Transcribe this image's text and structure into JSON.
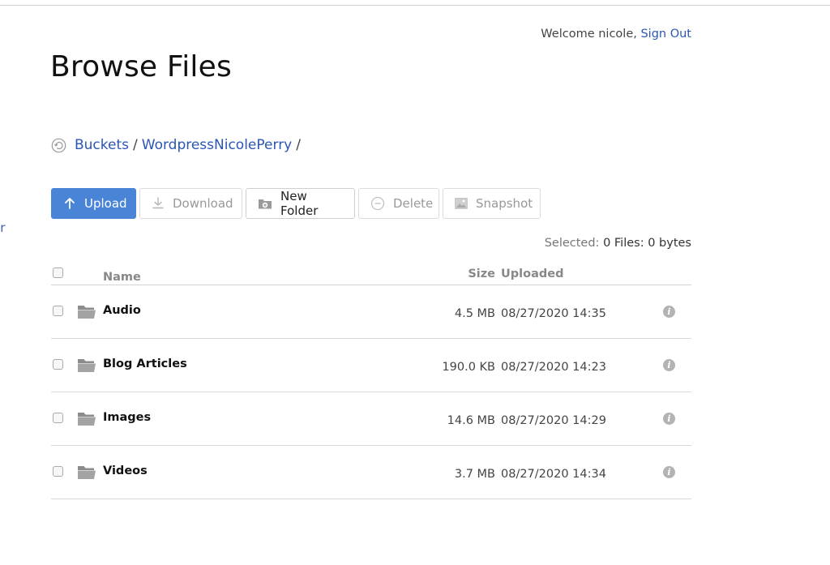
{
  "header": {
    "welcome_text": "Welcome nicole,",
    "sign_out": "Sign Out",
    "title": "Browse Files"
  },
  "left_fragment": "er",
  "breadcrumb": {
    "root": "Buckets",
    "separator": "/",
    "bucket": "WordpressNicolePerry",
    "trailing": "/"
  },
  "toolbar": {
    "upload": "Upload",
    "download": "Download",
    "new_folder": "New Folder",
    "delete": "Delete",
    "snapshot": "Snapshot"
  },
  "selection": {
    "label": "Selected:",
    "value": "0 Files: 0 bytes"
  },
  "table": {
    "columns": {
      "name": "Name",
      "size": "Size",
      "uploaded": "Uploaded"
    },
    "rows": [
      {
        "name": "Audio",
        "size": "4.5 MB",
        "uploaded": "08/27/2020 14:35"
      },
      {
        "name": "Blog Articles",
        "size": "190.0 KB",
        "uploaded": "08/27/2020 14:23"
      },
      {
        "name": "Images",
        "size": "14.6 MB",
        "uploaded": "08/27/2020 14:29"
      },
      {
        "name": "Videos",
        "size": "3.7 MB",
        "uploaded": "08/27/2020 14:34"
      }
    ],
    "info_glyph": "i"
  },
  "icons": {
    "upload": "arrow-up-icon",
    "download": "download-icon",
    "new_folder": "folder-plus-icon",
    "delete": "minus-circle-icon",
    "snapshot": "image-icon",
    "row": "folder-icon",
    "back": "back-arrow-icon",
    "info": "info-icon"
  },
  "colors": {
    "primary_button": "#4a84d6",
    "link": "#2b56b3"
  }
}
